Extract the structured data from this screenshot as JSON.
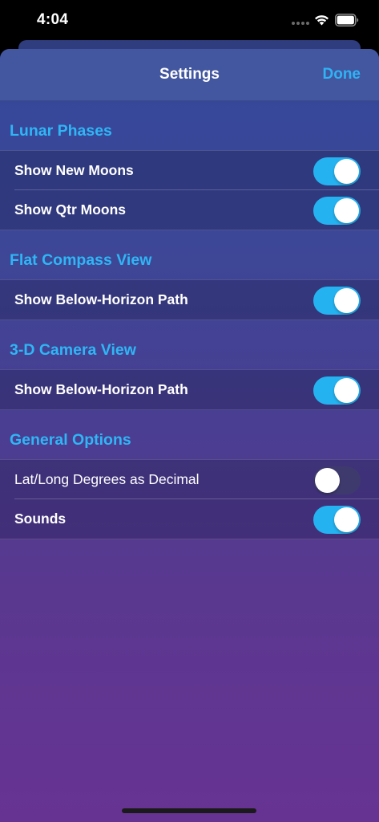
{
  "status_bar": {
    "time": "4:04"
  },
  "nav": {
    "title": "Settings",
    "done_label": "Done"
  },
  "colors": {
    "accent": "#2fb6f5",
    "toggle_on": "#24b2f0",
    "nav_bar": "#4357a0"
  },
  "sections": [
    {
      "header": "Lunar Phases",
      "rows": [
        {
          "label": "Show New Moons",
          "on": true
        },
        {
          "label": "Show Qtr Moons",
          "on": true
        }
      ]
    },
    {
      "header": "Flat Compass View",
      "rows": [
        {
          "label": "Show Below-Horizon Path",
          "on": true
        }
      ]
    },
    {
      "header": "3-D Camera View",
      "rows": [
        {
          "label": "Show Below-Horizon Path",
          "on": true
        }
      ]
    },
    {
      "header": "General Options",
      "rows": [
        {
          "label": "Lat/Long Degrees as Decimal",
          "on": false
        },
        {
          "label": "Sounds",
          "on": true
        }
      ]
    }
  ]
}
